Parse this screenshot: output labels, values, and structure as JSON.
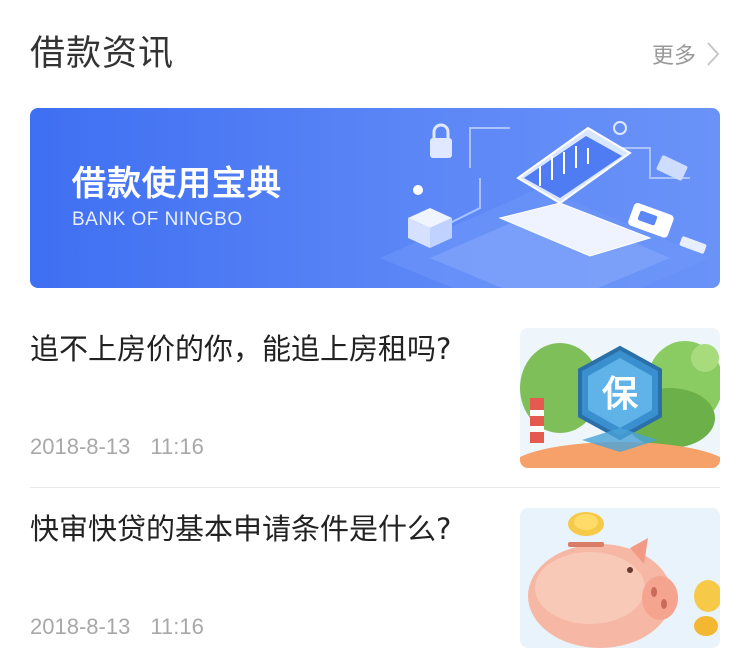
{
  "section": {
    "title": "借款资讯",
    "more_label": "更多"
  },
  "banner": {
    "title": "借款使用宝典",
    "subtitle": "BANK OF NINGBO"
  },
  "articles": [
    {
      "title": "追不上房价的你，能追上房租吗?",
      "date": "2018-8-13 11:16",
      "thumbnail_icon": "insurance-shield-icon",
      "thumbnail_badge": "保"
    },
    {
      "title": "快审快贷的基本申请条件是什么?",
      "date": "2018-8-13 11:16",
      "thumbnail_icon": "piggy-bank-icon"
    }
  ],
  "colors": {
    "banner_start": "#3f6ff2",
    "banner_end": "#6a93f8",
    "title_text": "#333333",
    "muted_text": "#a8a8a8"
  }
}
